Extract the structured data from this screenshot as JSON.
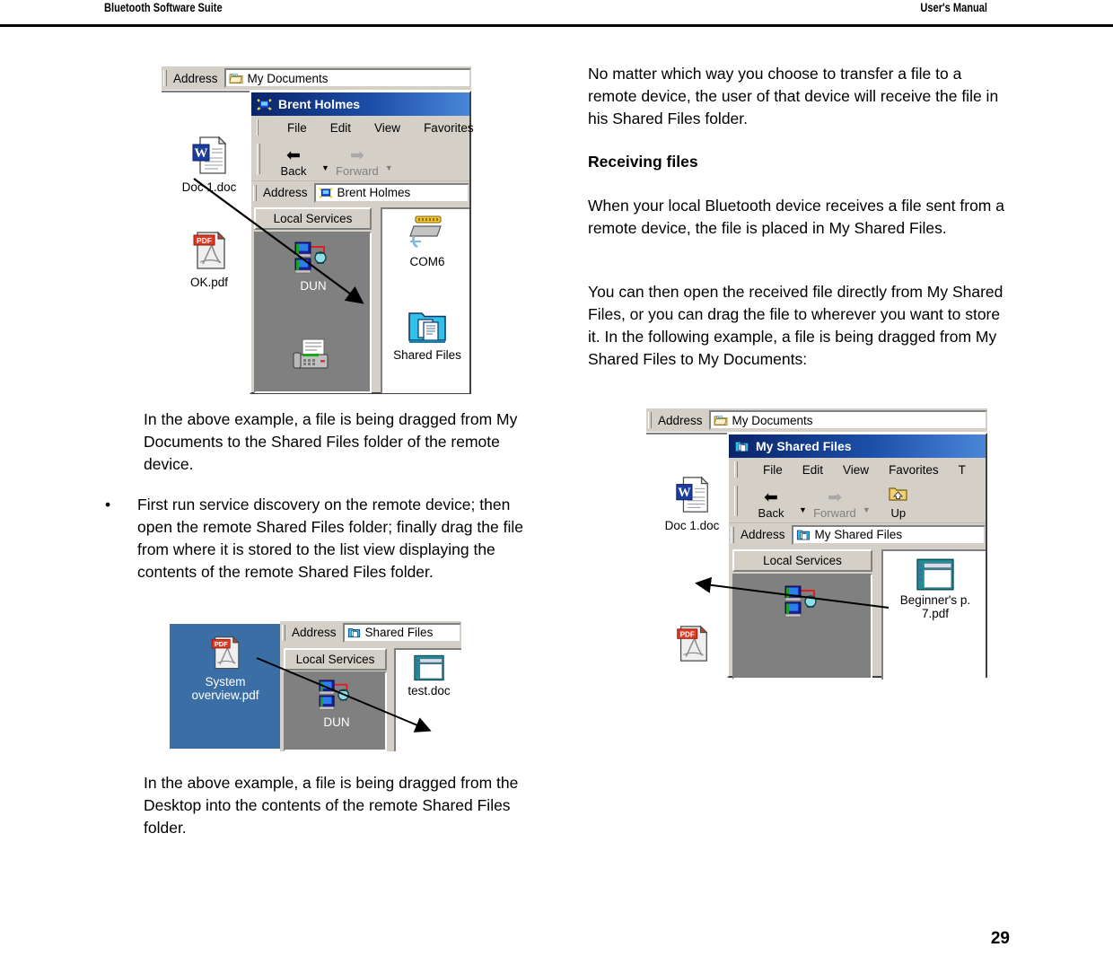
{
  "header": {
    "left_title": "Bluetooth Software Suite",
    "right_title": "User's Manual"
  },
  "page_number": "29",
  "left_column": {
    "caption_1": "In the above example, a file is being dragged from My Documents to the Shared Files folder of the remote device.",
    "bullet_marker": "•",
    "bullet_1": "First run service discovery on the remote device; then open the remote Shared Files folder; finally drag the file from where it is stored to the list view displaying the contents of the remote Shared Files folder.",
    "caption_2": "In the above example, a file is being dragged from the Desktop into the contents of the remote Shared Files folder."
  },
  "right_column": {
    "para_1": "No matter which way you choose to transfer a file to a remote device, the user of that device will receive the file in his Shared Files folder.",
    "heading_1": "Receiving files",
    "para_2": "When your local Bluetooth device receives a file sent from a remote device, the file is placed in My Shared Files.",
    "para_3": "You can then open the received file directly from My Shared Files, or you can drag the file to wherever you want to store it. In the following example, a file is being dragged from My Shared Files to My Documents:"
  },
  "figure_1": {
    "name": "drag-from-my-documents-to-shared-files",
    "host_address_label": "Address",
    "host_address_value": "My Documents",
    "desktop_files": [
      {
        "name": "Doc 1.doc",
        "icon": "word-document-icon"
      },
      {
        "name": "OK.pdf",
        "icon": "pdf-document-icon"
      }
    ],
    "window": {
      "title": "Brent Holmes",
      "title_icon": "bluetooth-device-icon",
      "menu": [
        "File",
        "Edit",
        "View",
        "Favorites"
      ],
      "toolbar": [
        {
          "label": "Back",
          "icon": "arrow-left-icon",
          "enabled": true
        },
        {
          "label": "Forward",
          "icon": "arrow-right-icon",
          "enabled": false
        }
      ],
      "address_label": "Address",
      "address_value": "Brent Holmes",
      "address_icon": "bluetooth-device-icon",
      "pane_tab": "Local Services",
      "services": [
        {
          "name": "DUN",
          "icon": "dialup-networking-icon"
        },
        {
          "name": "",
          "icon": "fax-icon"
        }
      ],
      "files": [
        {
          "name": "COM6",
          "icon": "serial-port-icon"
        },
        {
          "name": "Shared Files",
          "icon": "shared-folder-icon"
        }
      ]
    }
  },
  "figure_2": {
    "name": "drag-from-desktop-to-remote-shared-files",
    "desktop_files": [
      {
        "name": "System\noverview.pdf",
        "icon": "pdf-document-icon"
      }
    ],
    "window": {
      "address_label": "Address",
      "address_value": "Shared Files",
      "address_icon": "shared-folder-icon",
      "pane_tab": "Local Services",
      "services": [
        {
          "name": "DUN",
          "icon": "dialup-networking-icon"
        }
      ],
      "files": [
        {
          "name": "test.doc",
          "icon": "generic-file-icon"
        }
      ]
    }
  },
  "figure_3": {
    "name": "drag-from-my-shared-files-to-my-documents",
    "host_address_label": "Address",
    "host_address_value": "My Documents",
    "desktop_files": [
      {
        "name": "Doc 1.doc",
        "icon": "word-document-icon"
      },
      {
        "name": "",
        "icon": "pdf-document-icon"
      }
    ],
    "window": {
      "title": "My Shared Files",
      "title_icon": "shared-folder-icon",
      "menu": [
        "File",
        "Edit",
        "View",
        "Favorites",
        "T"
      ],
      "toolbar": [
        {
          "label": "Back",
          "icon": "arrow-left-icon",
          "enabled": true
        },
        {
          "label": "Forward",
          "icon": "arrow-right-icon",
          "enabled": false
        },
        {
          "label": "Up",
          "icon": "folder-up-icon",
          "enabled": true
        }
      ],
      "address_label": "Address",
      "address_value": "My Shared Files",
      "address_icon": "shared-folder-icon",
      "pane_tab": "Local Services",
      "services": [
        {
          "name": "",
          "icon": "dialup-networking-icon"
        }
      ],
      "files": [
        {
          "name": "Beginner's p.\n7.pdf",
          "icon": "generic-file-icon"
        }
      ]
    }
  },
  "colors": {
    "titlebar_blue": "#0a246a",
    "desktop_blue": "#3a6ea5",
    "window_face": "#d4d0c8",
    "pane_grey": "#808080",
    "shared_folder_cyan": "#22b5e0"
  }
}
